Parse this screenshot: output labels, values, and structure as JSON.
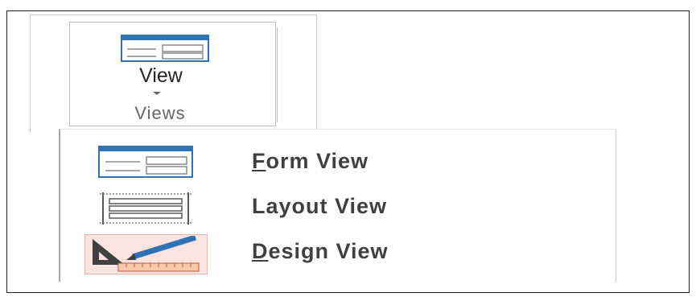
{
  "ribbon": {
    "view_button_label": "View",
    "group_label": "Views",
    "view_icon": "form-view-icon",
    "dropdown_icon": "chevron-down-icon"
  },
  "menu": {
    "items": [
      {
        "label_access_key": "F",
        "label_rest": "orm View",
        "label": "Form View",
        "icon": "form-view-icon"
      },
      {
        "label": "Layout View",
        "icon": "layout-view-icon"
      },
      {
        "label_access_key": "D",
        "label_rest": "esign View",
        "label": "Design View",
        "icon": "design-view-icon",
        "highlighted": true
      }
    ]
  },
  "colors": {
    "icon_blue": "#2e74b5",
    "icon_gray": "#7f7f7f",
    "design_highlight": "#fbe3df",
    "text": "#404040"
  }
}
